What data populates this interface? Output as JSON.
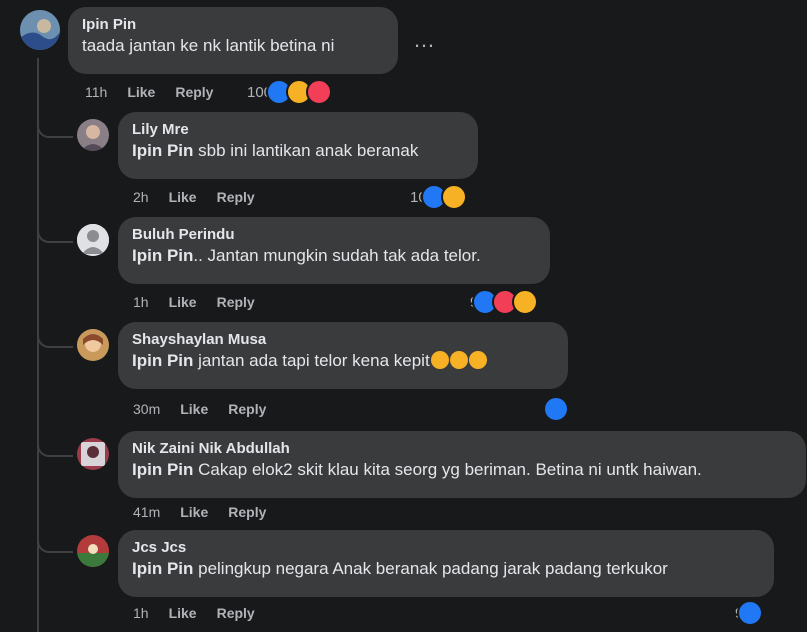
{
  "colors": {
    "background": "#18191a",
    "bubble": "#3a3b3c",
    "like": "#2078f4",
    "haha": "#f7b125",
    "love": "#f33e58"
  },
  "comments": [
    {
      "author": "Ipin Pin",
      "mention": "",
      "text": "taada jantan ke nk lantik betina ni",
      "time": "11h",
      "like_label": "Like",
      "reply_label": "Reply",
      "reaction_count": "100",
      "reactions": [
        "like",
        "haha",
        "love"
      ],
      "more_icon": "…"
    },
    {
      "author": "Lily Mre",
      "mention": "Ipin Pin",
      "text": " sbb ini lantikan anak beranak",
      "time": "2h",
      "like_label": "Like",
      "reply_label": "Reply",
      "reaction_count": "10",
      "reactions": [
        "like",
        "haha"
      ]
    },
    {
      "author": "Buluh Perindu",
      "mention": "Ipin Pin",
      "text": ".. Jantan mungkin sudah tak ada telor.",
      "time": "1h",
      "like_label": "Like",
      "reply_label": "Reply",
      "reaction_count": "9",
      "reactions": [
        "like",
        "love",
        "haha"
      ]
    },
    {
      "author": "Shayshaylan Musa",
      "mention": "Ipin Pin",
      "text": " jantan ada tapi telor kena kepit",
      "emoji_suffix": "rofl x3",
      "time": "30m",
      "like_label": "Like",
      "reply_label": "Reply",
      "reaction_count": "",
      "reactions": [
        "like"
      ]
    },
    {
      "author": "Nik Zaini Nik Abdullah",
      "mention": "Ipin Pin",
      "text": " Cakap elok2 skit klau kita seorg yg beriman. Betina ni untk haiwan.",
      "time": "41m",
      "like_label": "Like",
      "reply_label": "Reply",
      "reaction_count": "",
      "reactions": []
    },
    {
      "author": "Jcs Jcs",
      "mention": "Ipin Pin",
      "text": " pelingkup negara Anak beranak padang jarak padang terkukor",
      "time": "1h",
      "like_label": "Like",
      "reply_label": "Reply",
      "reaction_count": "9",
      "reactions": [
        "like"
      ]
    }
  ]
}
